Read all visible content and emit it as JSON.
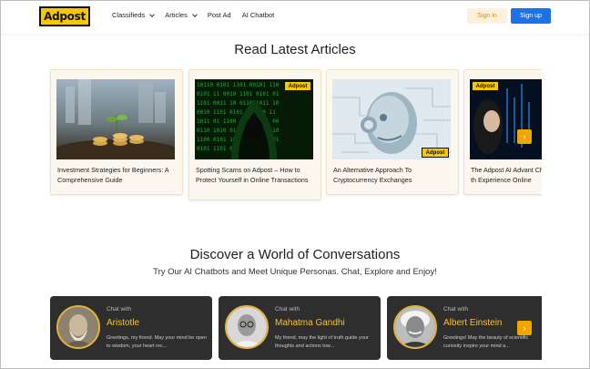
{
  "header": {
    "logo_text": "Adpost",
    "nav": [
      {
        "label": "Classifieds",
        "has_dropdown": true
      },
      {
        "label": "Articles",
        "has_dropdown": true
      },
      {
        "label": "Post Ad",
        "has_dropdown": false
      },
      {
        "label": "AI Chatbot",
        "has_dropdown": false
      }
    ],
    "signin_label": "Sign in",
    "signup_label": "Sign up"
  },
  "articles": {
    "title": "Read Latest Articles",
    "items": [
      {
        "caption": "Investment Strategies for Beginners: A Comprehensive Guide",
        "badge": ""
      },
      {
        "caption": "Spotting Scams on Adpost – How to Protect Yourself in Online Transactions",
        "badge": "Adpost"
      },
      {
        "caption": "An Alternative Approach To Cryptocurrency Exchanges",
        "badge": "Adpost"
      },
      {
        "caption": "The Adpost AI Advant Chatbots Transform th Experience Online",
        "badge": "Adpost"
      }
    ],
    "next_arrow": "›"
  },
  "chatbots": {
    "title": "Discover a World of Conversations",
    "subtitle": "Try Our AI Chatbots and Meet Unique Personas. Chat, Explore and Enjoy!",
    "items": [
      {
        "chat_with": "Chat with",
        "name": "Aristotle",
        "desc": "Greetings, my friend. May your mind be open to wisdom, your heart rec..."
      },
      {
        "chat_with": "Chat with",
        "name": "Mahatma Gandhi",
        "desc": "My friend, may the light of truth guide your thoughts and actions tow..."
      },
      {
        "chat_with": "Chat with",
        "name": "Albert Einstein",
        "desc": "Greetings! May the beauty of scientific curiosity inspire your mind a..."
      }
    ],
    "next_arrow": "›"
  },
  "colors": {
    "brand_yellow": "#f5c800",
    "primary_blue": "#1a73e8",
    "accent_orange": "#f0a500",
    "chat_card_bg": "#2e2e2e",
    "chat_name": "#f5c233"
  }
}
